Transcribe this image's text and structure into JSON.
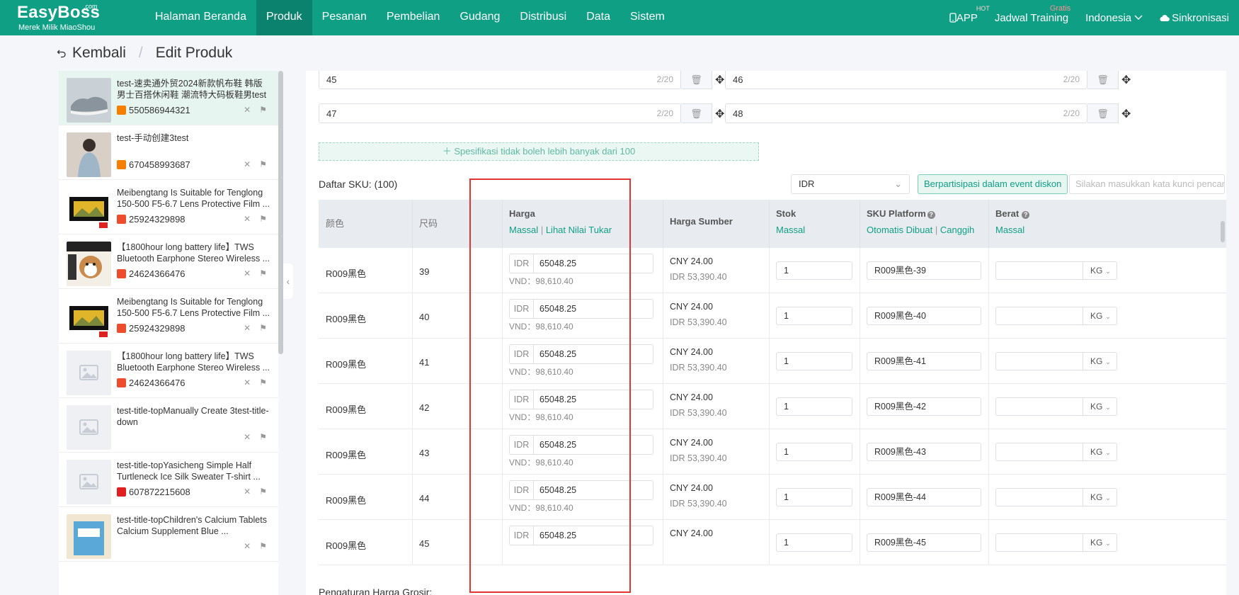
{
  "nav": {
    "logo": "EasyBoss",
    "logo_com": ".com",
    "logo_sub": "Merek Milik MiaoShou",
    "menu": [
      {
        "label": "Halaman Beranda"
      },
      {
        "label": "Produk",
        "active": true
      },
      {
        "label": "Pesanan"
      },
      {
        "label": "Pembelian"
      },
      {
        "label": "Gudang"
      },
      {
        "label": "Distribusi"
      },
      {
        "label": "Data"
      },
      {
        "label": "Sistem"
      }
    ],
    "app_label": "APP",
    "app_badge": "HOT",
    "training_label": "Jadwal Training",
    "training_badge": "Gratis",
    "language": "Indonesia",
    "sync_label": "Sinkronisasi"
  },
  "breadcrumb": {
    "back": "Kembali",
    "separator": "/",
    "current": "Edit Produk"
  },
  "sidebar": {
    "items": [
      {
        "title": "test-速卖通外贸2024新款帆布鞋 韩版男士百搭休闲鞋 潮流特大码板鞋男test",
        "id": "550586944321",
        "store_color": "#f77f00",
        "thumb": "shoe",
        "active": true
      },
      {
        "title": "test-手动创建3test",
        "id": "670458993687",
        "store_color": "#f77f00",
        "thumb": "person"
      },
      {
        "title": "Meibengtang Is Suitable for Tenglong 150-500 F5-6.7 Lens Protective Film ...",
        "id": "25924329898",
        "store_color": "#ee4d2d",
        "thumb": "film"
      },
      {
        "title": "【1800hour long battery life】TWS Bluetooth Earphone Stereo Wireless ...",
        "id": "24624366476",
        "store_color": "#ee4d2d",
        "thumb": "dog"
      },
      {
        "title": "Meibengtang Is Suitable for Tenglong 150-500 F5-6.7 Lens Protective Film ...",
        "id": "25924329898",
        "store_color": "#ee4d2d",
        "thumb": "film"
      },
      {
        "title": "【1800hour long battery life】TWS Bluetooth Earphone Stereo Wireless ...",
        "id": "24624366476",
        "store_color": "#ee4d2d",
        "thumb": "placeholder"
      },
      {
        "title": "test-title-topManually Create 3test-title-down",
        "id": "",
        "store_color": "",
        "thumb": "placeholder"
      },
      {
        "title": "test-title-topYasicheng Simple Half Turtleneck Ice Silk Sweater T-shirt ...",
        "id": "607872215608",
        "store_color": "#e02020",
        "thumb": "placeholder"
      },
      {
        "title": "test-title-topChildren's Calcium Tablets Calcium Supplement Blue ...",
        "id": "",
        "store_color": "",
        "thumb": "box"
      }
    ]
  },
  "specs": [
    {
      "value": "45",
      "count": "2/20"
    },
    {
      "value": "46",
      "count": "2/20"
    },
    {
      "value": "47",
      "count": "2/20"
    },
    {
      "value": "48",
      "count": "2/20"
    }
  ],
  "spec_warning": "Spesifikasi tidak boleh lebih banyak dari 100",
  "sku": {
    "label": "Daftar SKU:",
    "count": "(100)",
    "currency": "IDR",
    "discount_button": "Berpartisipasi dalam event diskon",
    "keyword_placeholder": "Silakan masukkan kata kunci pencarian"
  },
  "table": {
    "headers": {
      "color": "颜色",
      "size": "尺码",
      "price": "Harga",
      "price_bulk": "Massal",
      "price_sep": "|",
      "price_rate": "Lihat Nilai Tukar",
      "source_price": "Harga Sumber",
      "stock": "Stok",
      "stock_bulk": "Massal",
      "platform_sku": "SKU Platform",
      "platform_auto": "Otomatis Dibuat",
      "platform_sep": "|",
      "platform_adv": "Canggih",
      "weight": "Berat",
      "weight_bulk": "Massal"
    },
    "rows": [
      {
        "color": "R009黑色",
        "size": "39",
        "price_cur": "IDR",
        "price": "65048.25",
        "vnd": "VND：98,610.40",
        "src_cny": "CNY 24.00",
        "src_idr": "IDR 53,390.40",
        "stock": "1",
        "sku": "R009黑色-39",
        "weight": "",
        "unit": "KG"
      },
      {
        "color": "R009黑色",
        "size": "40",
        "price_cur": "IDR",
        "price": "65048.25",
        "vnd": "VND：98,610.40",
        "src_cny": "CNY 24.00",
        "src_idr": "IDR 53,390.40",
        "stock": "1",
        "sku": "R009黑色-40",
        "weight": "",
        "unit": "KG"
      },
      {
        "color": "R009黑色",
        "size": "41",
        "price_cur": "IDR",
        "price": "65048.25",
        "vnd": "VND：98,610.40",
        "src_cny": "CNY 24.00",
        "src_idr": "IDR 53,390.40",
        "stock": "1",
        "sku": "R009黑色-41",
        "weight": "",
        "unit": "KG"
      },
      {
        "color": "R009黑色",
        "size": "42",
        "price_cur": "IDR",
        "price": "65048.25",
        "vnd": "VND：98,610.40",
        "src_cny": "CNY 24.00",
        "src_idr": "IDR 53,390.40",
        "stock": "1",
        "sku": "R009黑色-42",
        "weight": "",
        "unit": "KG"
      },
      {
        "color": "R009黑色",
        "size": "43",
        "price_cur": "IDR",
        "price": "65048.25",
        "vnd": "VND：98,610.40",
        "src_cny": "CNY 24.00",
        "src_idr": "IDR 53,390.40",
        "stock": "1",
        "sku": "R009黑色-43",
        "weight": "",
        "unit": "KG"
      },
      {
        "color": "R009黑色",
        "size": "44",
        "price_cur": "IDR",
        "price": "65048.25",
        "vnd": "VND：98,610.40",
        "src_cny": "CNY 24.00",
        "src_idr": "IDR 53,390.40",
        "stock": "1",
        "sku": "R009黑色-44",
        "weight": "",
        "unit": "KG"
      },
      {
        "color": "R009黑色",
        "size": "45",
        "price_cur": "IDR",
        "price": "65048.25",
        "vnd": "",
        "src_cny": "CNY 24.00",
        "src_idr": "",
        "stock": "1",
        "sku": "R009黑色-45",
        "weight": "",
        "unit": "KG"
      }
    ]
  },
  "grosir_label": "Pengaturan Harga Grosir:",
  "colors": {
    "brand": "#0e9f85",
    "highlight": "#e53333"
  }
}
